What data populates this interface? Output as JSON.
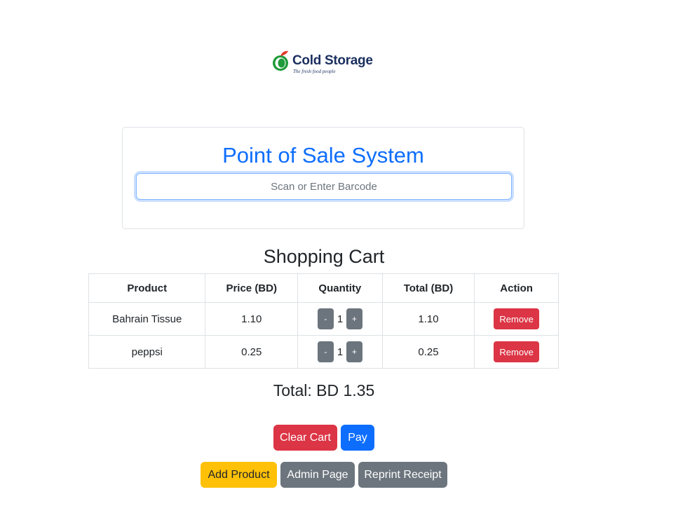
{
  "brand": {
    "name": "Cold Storage",
    "tagline": "The fresh food people",
    "colors": {
      "navy": "#1b2f5e",
      "green": "#1e9a3a",
      "red": "#e03c2c"
    }
  },
  "scan_panel": {
    "title": "Point of Sale System",
    "barcode_placeholder": "Scan or Enter Barcode",
    "barcode_value": ""
  },
  "cart": {
    "title": "Shopping Cart",
    "columns": [
      "Product",
      "Price (BD)",
      "Quantity",
      "Total (BD)",
      "Action"
    ],
    "rows": [
      {
        "product": "Bahrain Tissue",
        "price": "1.10",
        "quantity": "1",
        "total": "1.10",
        "decrement_label": "-",
        "increment_label": "+",
        "remove_label": "Remove"
      },
      {
        "product": "peppsi",
        "price": "0.25",
        "quantity": "1",
        "total": "0.25",
        "decrement_label": "-",
        "increment_label": "+",
        "remove_label": "Remove"
      }
    ],
    "grand_total": "Total: BD 1.35"
  },
  "actions": {
    "clear_cart": "Clear Cart",
    "pay": "Pay",
    "add_product": "Add Product",
    "admin_page": "Admin Page",
    "reprint_receipt": "Reprint Receipt"
  },
  "colors": {
    "primary": "#0d6efd",
    "danger": "#dc3545",
    "warning": "#ffc107",
    "secondary": "#6c757d"
  }
}
